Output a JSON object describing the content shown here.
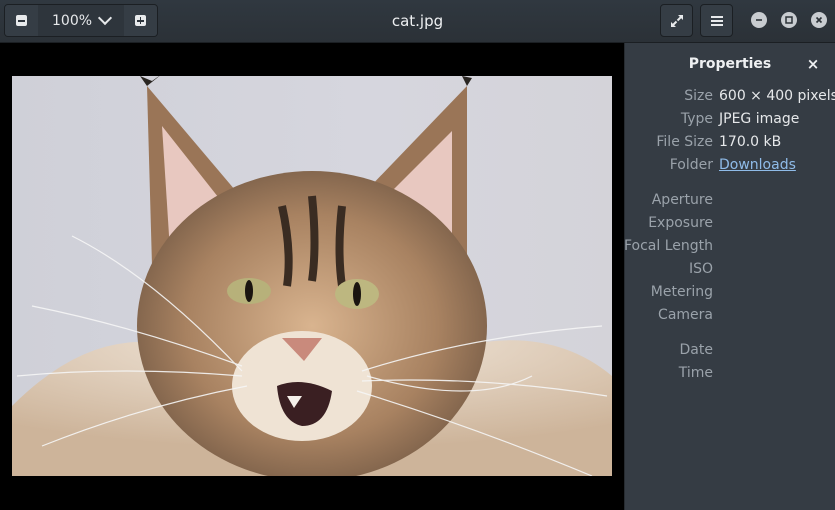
{
  "header": {
    "zoom_value": "100%",
    "title": "cat.jpg"
  },
  "image": {
    "description_icon": "cat-photo"
  },
  "sidebar": {
    "title": "Properties",
    "close_glyph": "×",
    "file_props": [
      {
        "label": "Size",
        "value": "600 × 400 pixels"
      },
      {
        "label": "Type",
        "value": "JPEG image"
      },
      {
        "label": "File Size",
        "value": "170.0 kB"
      },
      {
        "label": "Folder",
        "value": "Downloads"
      }
    ],
    "exif_props": [
      {
        "label": "Aperture"
      },
      {
        "label": "Exposure"
      },
      {
        "label": "Focal Length"
      },
      {
        "label": "ISO"
      },
      {
        "label": "Metering"
      },
      {
        "label": "Camera"
      }
    ],
    "date_props": [
      {
        "label": "Date"
      },
      {
        "label": "Time"
      }
    ]
  },
  "colors": {
    "headerbar": "#2b3137",
    "sidebar": "#353c44",
    "link": "#8fbbe8"
  }
}
